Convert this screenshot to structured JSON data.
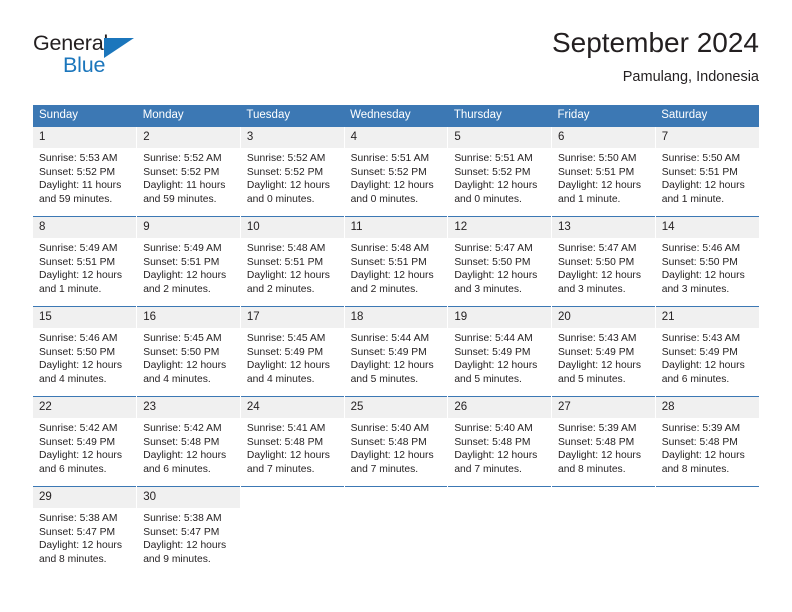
{
  "brand": {
    "name_part1": "General",
    "name_part2": "Blue",
    "logo_icon": "triangle-logo-icon",
    "accent_color": "#1b76bc"
  },
  "header": {
    "title": "September 2024",
    "location": "Pamulang, Indonesia"
  },
  "theme": {
    "header_row_bg": "#3c78b4",
    "daynum_bg": "#f0f0f0",
    "text_color": "#231f20"
  },
  "weekday_headers": [
    "Sunday",
    "Monday",
    "Tuesday",
    "Wednesday",
    "Thursday",
    "Friday",
    "Saturday"
  ],
  "weeks": [
    [
      {
        "day": "1",
        "sunrise": "Sunrise: 5:53 AM",
        "sunset": "Sunset: 5:52 PM",
        "daylight_line1": "Daylight: 11 hours",
        "daylight_line2": "and 59 minutes."
      },
      {
        "day": "2",
        "sunrise": "Sunrise: 5:52 AM",
        "sunset": "Sunset: 5:52 PM",
        "daylight_line1": "Daylight: 11 hours",
        "daylight_line2": "and 59 minutes."
      },
      {
        "day": "3",
        "sunrise": "Sunrise: 5:52 AM",
        "sunset": "Sunset: 5:52 PM",
        "daylight_line1": "Daylight: 12 hours",
        "daylight_line2": "and 0 minutes."
      },
      {
        "day": "4",
        "sunrise": "Sunrise: 5:51 AM",
        "sunset": "Sunset: 5:52 PM",
        "daylight_line1": "Daylight: 12 hours",
        "daylight_line2": "and 0 minutes."
      },
      {
        "day": "5",
        "sunrise": "Sunrise: 5:51 AM",
        "sunset": "Sunset: 5:52 PM",
        "daylight_line1": "Daylight: 12 hours",
        "daylight_line2": "and 0 minutes."
      },
      {
        "day": "6",
        "sunrise": "Sunrise: 5:50 AM",
        "sunset": "Sunset: 5:51 PM",
        "daylight_line1": "Daylight: 12 hours",
        "daylight_line2": "and 1 minute."
      },
      {
        "day": "7",
        "sunrise": "Sunrise: 5:50 AM",
        "sunset": "Sunset: 5:51 PM",
        "daylight_line1": "Daylight: 12 hours",
        "daylight_line2": "and 1 minute."
      }
    ],
    [
      {
        "day": "8",
        "sunrise": "Sunrise: 5:49 AM",
        "sunset": "Sunset: 5:51 PM",
        "daylight_line1": "Daylight: 12 hours",
        "daylight_line2": "and 1 minute."
      },
      {
        "day": "9",
        "sunrise": "Sunrise: 5:49 AM",
        "sunset": "Sunset: 5:51 PM",
        "daylight_line1": "Daylight: 12 hours",
        "daylight_line2": "and 2 minutes."
      },
      {
        "day": "10",
        "sunrise": "Sunrise: 5:48 AM",
        "sunset": "Sunset: 5:51 PM",
        "daylight_line1": "Daylight: 12 hours",
        "daylight_line2": "and 2 minutes."
      },
      {
        "day": "11",
        "sunrise": "Sunrise: 5:48 AM",
        "sunset": "Sunset: 5:51 PM",
        "daylight_line1": "Daylight: 12 hours",
        "daylight_line2": "and 2 minutes."
      },
      {
        "day": "12",
        "sunrise": "Sunrise: 5:47 AM",
        "sunset": "Sunset: 5:50 PM",
        "daylight_line1": "Daylight: 12 hours",
        "daylight_line2": "and 3 minutes."
      },
      {
        "day": "13",
        "sunrise": "Sunrise: 5:47 AM",
        "sunset": "Sunset: 5:50 PM",
        "daylight_line1": "Daylight: 12 hours",
        "daylight_line2": "and 3 minutes."
      },
      {
        "day": "14",
        "sunrise": "Sunrise: 5:46 AM",
        "sunset": "Sunset: 5:50 PM",
        "daylight_line1": "Daylight: 12 hours",
        "daylight_line2": "and 3 minutes."
      }
    ],
    [
      {
        "day": "15",
        "sunrise": "Sunrise: 5:46 AM",
        "sunset": "Sunset: 5:50 PM",
        "daylight_line1": "Daylight: 12 hours",
        "daylight_line2": "and 4 minutes."
      },
      {
        "day": "16",
        "sunrise": "Sunrise: 5:45 AM",
        "sunset": "Sunset: 5:50 PM",
        "daylight_line1": "Daylight: 12 hours",
        "daylight_line2": "and 4 minutes."
      },
      {
        "day": "17",
        "sunrise": "Sunrise: 5:45 AM",
        "sunset": "Sunset: 5:49 PM",
        "daylight_line1": "Daylight: 12 hours",
        "daylight_line2": "and 4 minutes."
      },
      {
        "day": "18",
        "sunrise": "Sunrise: 5:44 AM",
        "sunset": "Sunset: 5:49 PM",
        "daylight_line1": "Daylight: 12 hours",
        "daylight_line2": "and 5 minutes."
      },
      {
        "day": "19",
        "sunrise": "Sunrise: 5:44 AM",
        "sunset": "Sunset: 5:49 PM",
        "daylight_line1": "Daylight: 12 hours",
        "daylight_line2": "and 5 minutes."
      },
      {
        "day": "20",
        "sunrise": "Sunrise: 5:43 AM",
        "sunset": "Sunset: 5:49 PM",
        "daylight_line1": "Daylight: 12 hours",
        "daylight_line2": "and 5 minutes."
      },
      {
        "day": "21",
        "sunrise": "Sunrise: 5:43 AM",
        "sunset": "Sunset: 5:49 PM",
        "daylight_line1": "Daylight: 12 hours",
        "daylight_line2": "and 6 minutes."
      }
    ],
    [
      {
        "day": "22",
        "sunrise": "Sunrise: 5:42 AM",
        "sunset": "Sunset: 5:49 PM",
        "daylight_line1": "Daylight: 12 hours",
        "daylight_line2": "and 6 minutes."
      },
      {
        "day": "23",
        "sunrise": "Sunrise: 5:42 AM",
        "sunset": "Sunset: 5:48 PM",
        "daylight_line1": "Daylight: 12 hours",
        "daylight_line2": "and 6 minutes."
      },
      {
        "day": "24",
        "sunrise": "Sunrise: 5:41 AM",
        "sunset": "Sunset: 5:48 PM",
        "daylight_line1": "Daylight: 12 hours",
        "daylight_line2": "and 7 minutes."
      },
      {
        "day": "25",
        "sunrise": "Sunrise: 5:40 AM",
        "sunset": "Sunset: 5:48 PM",
        "daylight_line1": "Daylight: 12 hours",
        "daylight_line2": "and 7 minutes."
      },
      {
        "day": "26",
        "sunrise": "Sunrise: 5:40 AM",
        "sunset": "Sunset: 5:48 PM",
        "daylight_line1": "Daylight: 12 hours",
        "daylight_line2": "and 7 minutes."
      },
      {
        "day": "27",
        "sunrise": "Sunrise: 5:39 AM",
        "sunset": "Sunset: 5:48 PM",
        "daylight_line1": "Daylight: 12 hours",
        "daylight_line2": "and 8 minutes."
      },
      {
        "day": "28",
        "sunrise": "Sunrise: 5:39 AM",
        "sunset": "Sunset: 5:48 PM",
        "daylight_line1": "Daylight: 12 hours",
        "daylight_line2": "and 8 minutes."
      }
    ],
    [
      {
        "day": "29",
        "sunrise": "Sunrise: 5:38 AM",
        "sunset": "Sunset: 5:47 PM",
        "daylight_line1": "Daylight: 12 hours",
        "daylight_line2": "and 8 minutes."
      },
      {
        "day": "30",
        "sunrise": "Sunrise: 5:38 AM",
        "sunset": "Sunset: 5:47 PM",
        "daylight_line1": "Daylight: 12 hours",
        "daylight_line2": "and 9 minutes."
      },
      {
        "day": "",
        "sunrise": "",
        "sunset": "",
        "daylight_line1": "",
        "daylight_line2": ""
      },
      {
        "day": "",
        "sunrise": "",
        "sunset": "",
        "daylight_line1": "",
        "daylight_line2": ""
      },
      {
        "day": "",
        "sunrise": "",
        "sunset": "",
        "daylight_line1": "",
        "daylight_line2": ""
      },
      {
        "day": "",
        "sunrise": "",
        "sunset": "",
        "daylight_line1": "",
        "daylight_line2": ""
      },
      {
        "day": "",
        "sunrise": "",
        "sunset": "",
        "daylight_line1": "",
        "daylight_line2": ""
      }
    ]
  ]
}
